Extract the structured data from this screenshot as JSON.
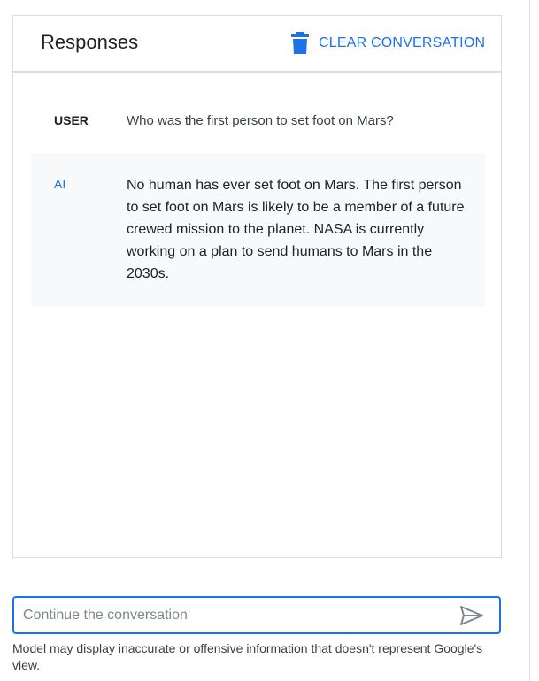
{
  "header": {
    "title": "Responses",
    "clear_label": "CLEAR CONVERSATION",
    "clear_icon": "trash-icon"
  },
  "conversation": [
    {
      "role": "USER",
      "text": "Who was the first person to set foot on Mars?"
    },
    {
      "role": "AI",
      "text": "No human has ever set foot on Mars. The first person to set foot on Mars is likely to be a member of a future crewed mission to the planet. NASA is currently working on a plan to send humans to Mars in the 2030s."
    }
  ],
  "composer": {
    "placeholder": "Continue the conversation",
    "value": "",
    "send_icon": "send-icon"
  },
  "disclaimer": "Model may display inaccurate or offensive information that doesn't represent Google's view.",
  "colors": {
    "accent": "#1a73e8",
    "border": "#dadce0",
    "ai_row_background": "#f8f9fa",
    "text": "#202124"
  }
}
